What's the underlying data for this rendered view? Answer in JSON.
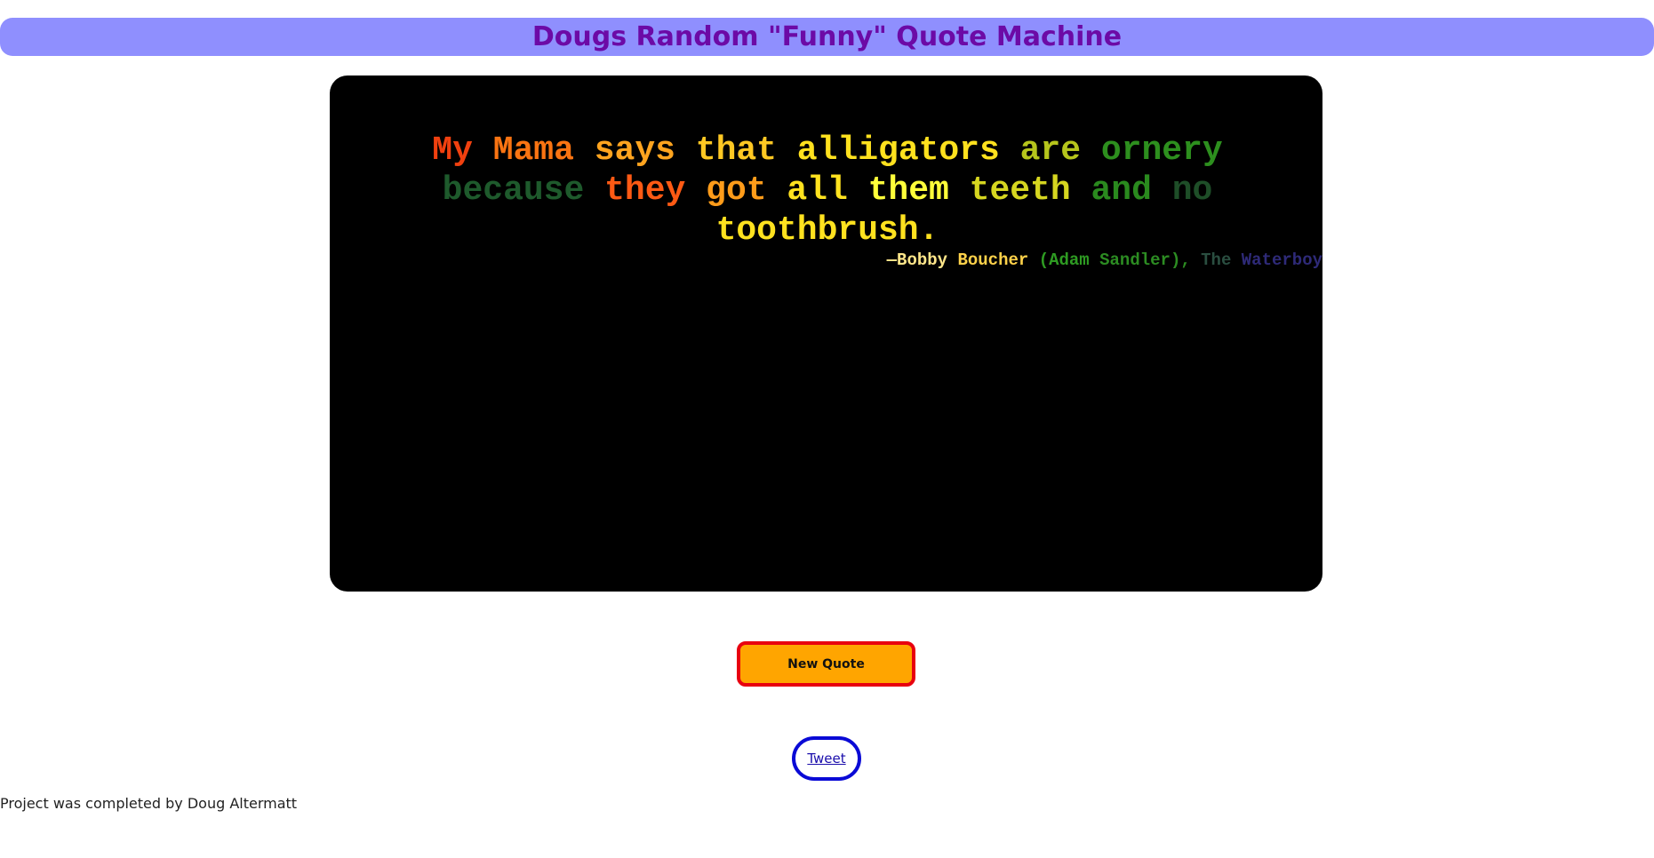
{
  "header": {
    "title": "Dougs Random \"Funny\" Quote Machine",
    "background_color": "#8f8ffe",
    "title_color": "#6c0aa6"
  },
  "quote": {
    "text_words": [
      "My",
      "Mama",
      "says",
      "that",
      "alligators",
      "are",
      "ornery",
      "because",
      "they",
      "got",
      "all",
      "them",
      "teeth",
      "and",
      "no",
      "toothbrush."
    ],
    "word_colors": [
      "#f0400f",
      "#fa7412",
      "#ffa41f",
      "#ffc823",
      "#ffe11e",
      "#b6c51c",
      "#2d8f1e",
      "#1e5a2c",
      "#ff5a14",
      "#ff9c1a",
      "#ffe21f",
      "#ffff3a",
      "#d6d620",
      "#2a8a1e",
      "#1e4e28",
      "#ffe21f"
    ],
    "author_words": [
      "—Bobby",
      "Boucher",
      "(Adam",
      "Sandler),",
      "The",
      "Waterboy"
    ],
    "author_colors": [
      "#ffe68a",
      "#ffd24a",
      "#2e9b22",
      "#2c8c22",
      "#2a4e40",
      "#2e2a78"
    ],
    "box_color": "#000000"
  },
  "buttons": {
    "new_quote_label": "New Quote",
    "new_quote_bg": "#ffa500",
    "new_quote_border": "#e8000f",
    "tweet_label": "Tweet",
    "tweet_border": "#0a0ad6"
  },
  "footer": {
    "text": "Project was completed by Doug Altermatt"
  }
}
